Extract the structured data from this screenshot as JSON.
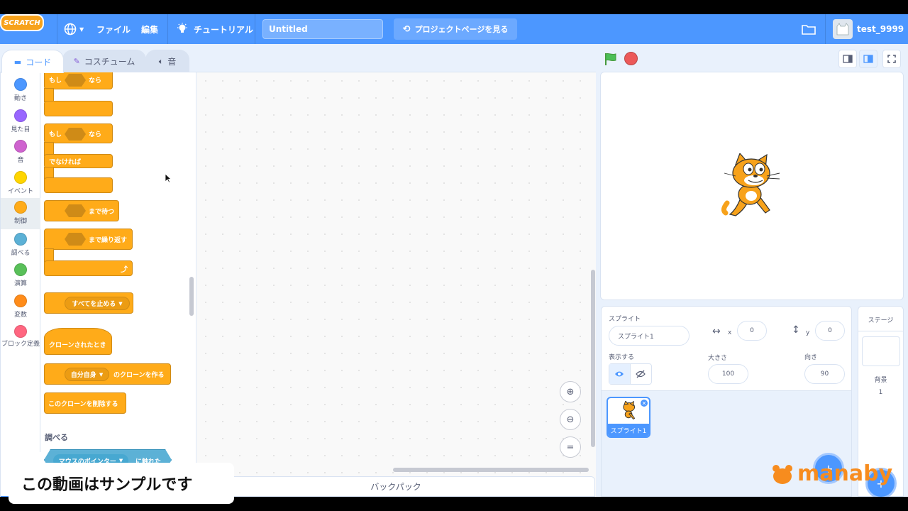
{
  "menubar": {
    "logo_text": "SCRATCH",
    "language_icon": "globe-icon",
    "file_label": "ファイル",
    "edit_label": "編集",
    "tutorials_label": "チュートリアル",
    "project_title": "Untitled",
    "see_project_label": "プロジェクトページを見る",
    "username": "test_9999"
  },
  "tabs": [
    {
      "label": "コード",
      "icon": "code-icon"
    },
    {
      "label": "コスチューム",
      "icon": "brush-icon"
    },
    {
      "label": "音",
      "icon": "speaker-icon"
    }
  ],
  "categories": [
    {
      "label": "動き",
      "color": "#4c97ff"
    },
    {
      "label": "見た目",
      "color": "#9966ff"
    },
    {
      "label": "音",
      "color": "#cf63cf"
    },
    {
      "label": "イベント",
      "color": "#ffd500"
    },
    {
      "label": "制御",
      "color": "#ffab19"
    },
    {
      "label": "調べる",
      "color": "#5cb1d6"
    },
    {
      "label": "演算",
      "color": "#59c059"
    },
    {
      "label": "変数",
      "color": "#ff8c1a"
    },
    {
      "label": "ブロック定義",
      "color": "#ff6680"
    }
  ],
  "blocks": {
    "if_then_if": "もし",
    "if_then_then": "なら",
    "if_else_if": "もし",
    "if_else_then": "なら",
    "if_else_else": "でなければ",
    "wait_until": "まで待つ",
    "repeat_until": "まで繰り返す",
    "stop_all": "すべてを止める",
    "when_clone": "クローンされたとき",
    "create_clone_target": "自分自身",
    "create_clone": "のクローンを作る",
    "delete_clone": "このクローンを削除する",
    "sensing_heading": "調べる",
    "touching_target": "マウスのポインター",
    "touching": "に触れた"
  },
  "backpack_label": "バックパック",
  "sprite_info": {
    "sprite_label": "スプライト",
    "sprite_name": "スプライト1",
    "x_label": "x",
    "x_value": "0",
    "y_label": "y",
    "y_value": "0",
    "show_label": "表示する",
    "size_label": "大きさ",
    "size_value": "100",
    "direction_label": "向き",
    "direction_value": "90"
  },
  "sprite_list": [
    {
      "name": "スプライト1",
      "selected": true
    }
  ],
  "stage_panel": {
    "title": "ステージ",
    "backdrops_label": "背景",
    "backdrops_count": "1"
  },
  "overlay": {
    "caption": "この動画はサンプルです",
    "watermark": "manaby"
  }
}
